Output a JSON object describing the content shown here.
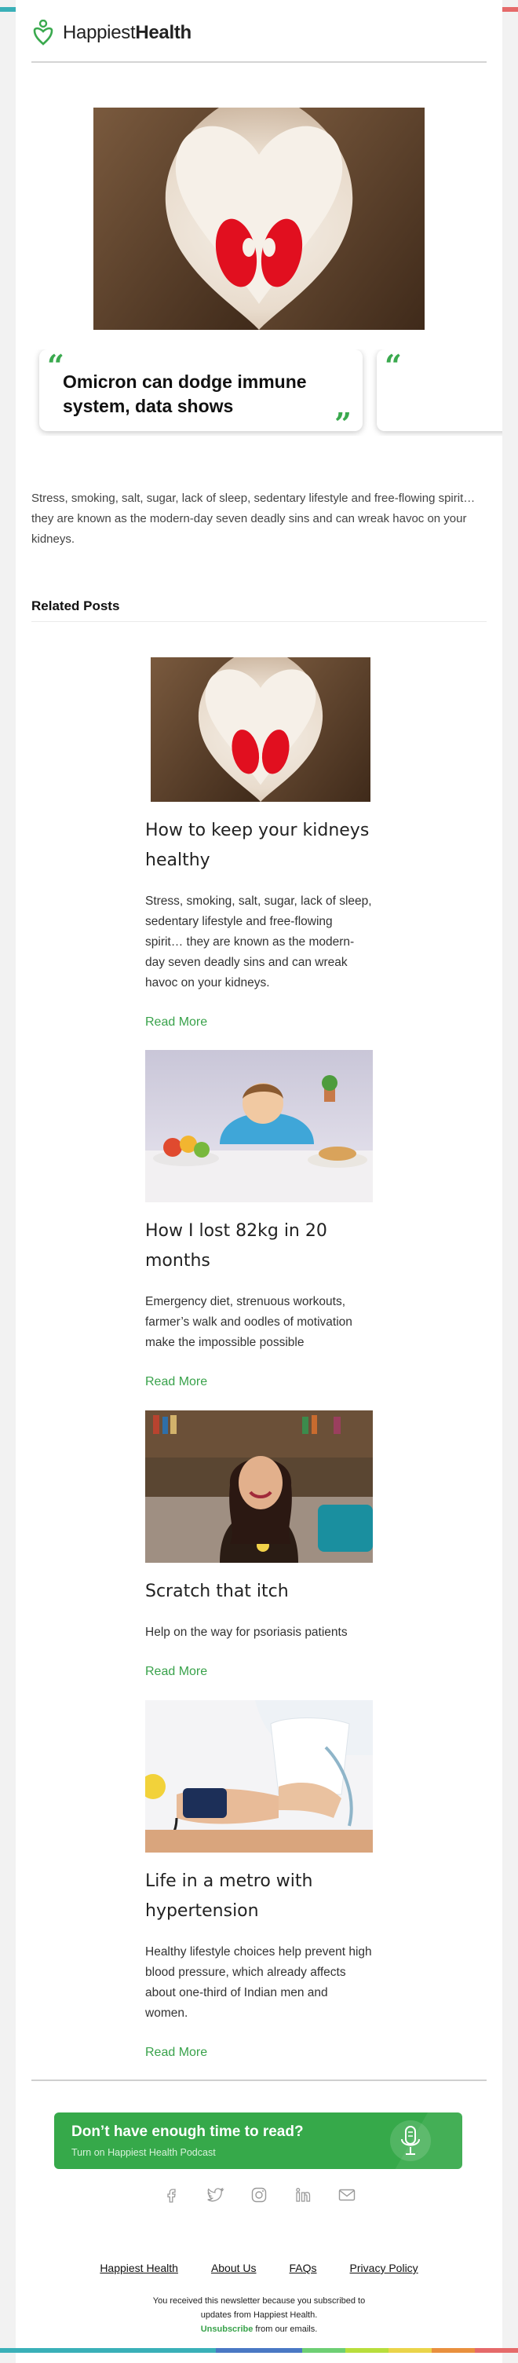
{
  "brand": {
    "name_light": "Happiest",
    "name_bold": "Health",
    "accent": "#3aa94e"
  },
  "stripe_colors": [
    "#3ab0b8",
    "#3ab0b8",
    "#3ab0b8",
    "#3ab0b8",
    "#3ab0b8",
    "#4a78c4",
    "#4a78c4",
    "#6ecf74",
    "#b8de3c",
    "#ead44a",
    "#e9903e",
    "#e56a6a"
  ],
  "hero": {
    "alt": "Hands forming a heart around kidneys"
  },
  "quotes": [
    {
      "text": "Omicron can dodge immune system, data shows"
    },
    {
      "text": ""
    }
  ],
  "intro": "Stress, smoking, salt, sugar, lack of sleep, sedentary lifestyle and free-flowing spirit… they are known as the modern-day seven deadly sins and can wreak havoc on your kidneys.",
  "related": {
    "heading": "Related Posts",
    "read_more": "Read More",
    "posts": [
      {
        "title": "How to keep your kidneys healthy",
        "excerpt": "Stress, smoking, salt, sugar, lack of sleep, sedentary lifestyle and free-flowing spirit… they are known as the modern-day seven deadly sins and can wreak havoc on your kidneys.",
        "image": "kidneys-heart-hands"
      },
      {
        "title": "How I lost 82kg in 20 months",
        "excerpt": "Emergency diet, strenuous workouts, farmer’s walk and oodles of motivation make the impossible possible",
        "image": "boy-with-food"
      },
      {
        "title": "Scratch that itch",
        "excerpt": "Help on the way for psoriasis patients",
        "image": "smiling-woman-on-sofa"
      },
      {
        "title": "Life in a metro with hypertension",
        "excerpt": "Healthy lifestyle choices help prevent high blood pressure, which already affects about one-third of Indian men and women.",
        "image": "blood-pressure-check"
      }
    ]
  },
  "podcast": {
    "headline": "Don’t have enough time to read?",
    "sub": "Turn on Happiest Health Podcast"
  },
  "socials": [
    "facebook-icon",
    "twitter-icon",
    "instagram-icon",
    "linkedin-icon",
    "mail-icon"
  ],
  "footer": {
    "links": [
      "Happiest Health",
      "About Us",
      "FAQs",
      "Privacy Policy"
    ],
    "notice_line1": "You received this newsletter because you subscribed to",
    "notice_line2": "updates from Happiest Health.",
    "unsubscribe": "Unsubscribe",
    "unsubscribe_suffix": " from our emails."
  }
}
